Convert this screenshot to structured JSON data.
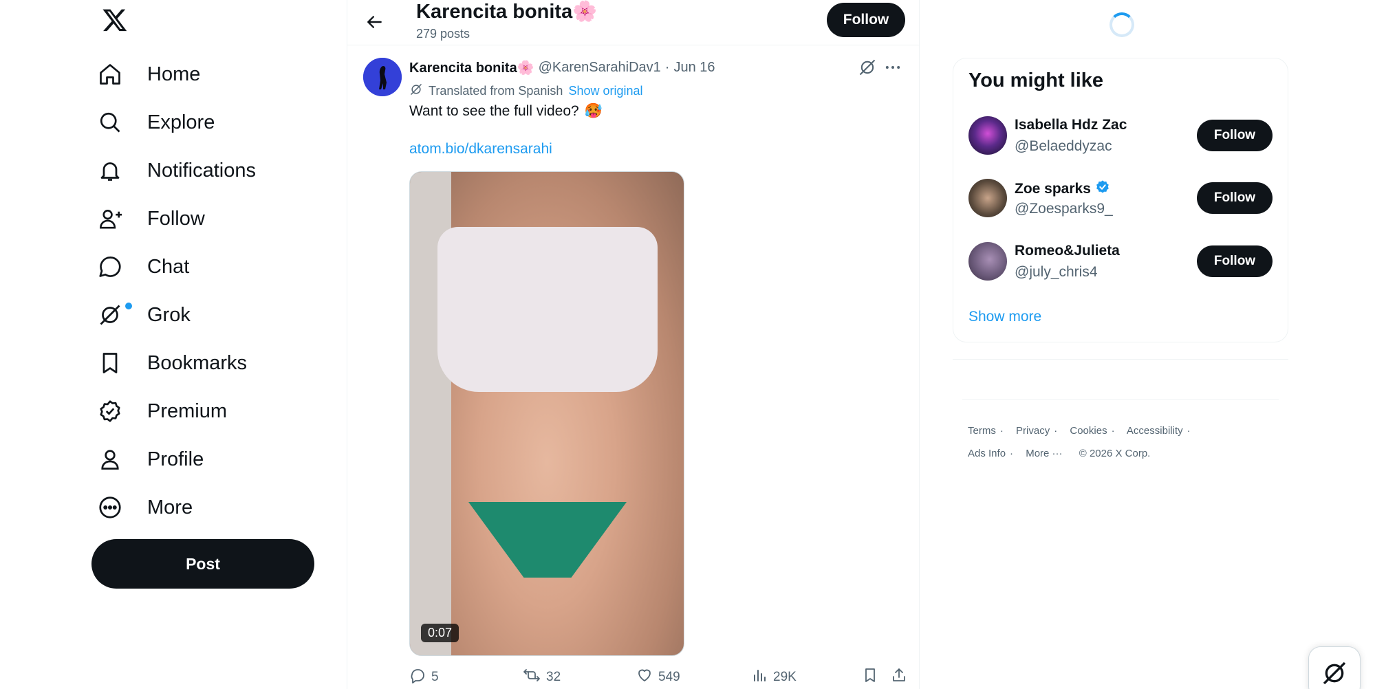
{
  "nav": {
    "logo_icon": "x-logo-icon",
    "items": [
      {
        "label": "Home",
        "icon": "home-icon"
      },
      {
        "label": "Explore",
        "icon": "search-icon"
      },
      {
        "label": "Notifications",
        "icon": "bell-icon"
      },
      {
        "label": "Follow",
        "icon": "person-add-icon"
      },
      {
        "label": "Chat",
        "icon": "chat-bubble-icon"
      },
      {
        "label": "Grok",
        "icon": "grok-icon"
      },
      {
        "label": "Bookmarks",
        "icon": "bookmark-icon"
      },
      {
        "label": "Premium",
        "icon": "verified-badge-icon"
      },
      {
        "label": "Profile",
        "icon": "person-icon"
      },
      {
        "label": "More",
        "icon": "more-circle-icon"
      }
    ],
    "post_label": "Post"
  },
  "header": {
    "name": "Karencita bonita",
    "name_emoji": "🌸",
    "posts_count": "279 posts",
    "follow_label": "Follow"
  },
  "tweet": {
    "author_name": "Karencita bonita",
    "author_emoji": "🌸",
    "handle": "@KarenSarahiDav1",
    "separator": "·",
    "date": "Jun 16",
    "translated_label": "Translated from Spanish",
    "show_original_label": "Show original",
    "text": "Want to see the full video?",
    "text_emoji": "🥵",
    "link": "atom.bio/dkarensarahi",
    "video_duration": "0:07",
    "replies": "5",
    "reposts": "32",
    "likes": "549",
    "views": "29K"
  },
  "sidebar": {
    "title": "You might like",
    "suggestions": [
      {
        "name": "Isabella Hdz Zac",
        "handle": "@Belaeddyzac",
        "verified": false,
        "follow_label": "Follow",
        "avatar_color": "#3a1f5c"
      },
      {
        "name": "Zoe sparks",
        "handle": "@Zoesparks9_",
        "verified": true,
        "follow_label": "Follow",
        "avatar_color": "#5a4a3c"
      },
      {
        "name": "Romeo&Julieta",
        "handle": "@july_chris4",
        "verified": false,
        "follow_label": "Follow",
        "avatar_color": "#6b5a7a"
      }
    ],
    "show_more_label": "Show more"
  },
  "footer": {
    "links": [
      "Terms",
      "Privacy",
      "Cookies",
      "Accessibility",
      "Ads Info",
      "More ···"
    ],
    "copyright": "© 2026 X Corp."
  },
  "colors": {
    "accent": "#1d9bf0",
    "text": "#0f1419",
    "muted": "#536471",
    "button_dark": "#0f1419"
  }
}
